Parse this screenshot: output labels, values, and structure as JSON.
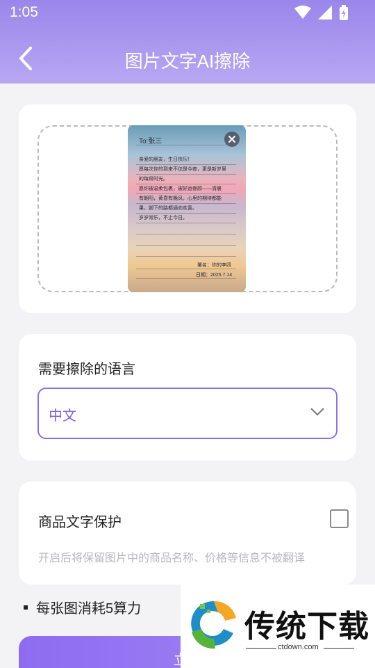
{
  "status_bar": {
    "time": "1:05"
  },
  "header": {
    "title": "图片文字AI擦除"
  },
  "upload": {
    "letter": {
      "to": "To:张三",
      "lines": [
        "亲爱的朋友，生日快乐！",
        "愿每次你的到来不仅是今夜，更是新岁里",
        "的每段时光。",
        "愿你被温柔包裹，被好运眷顾——清晨",
        "有朝阳，黄昏有晚风，心里的期待都能",
        "果，脚下的路都通向欢喜。",
        "岁岁常乐，不止今日。"
      ],
      "signature": "署名：你的李四",
      "date": "日期：2025.7.14"
    }
  },
  "language": {
    "label": "需要擦除的语言",
    "selected": "中文"
  },
  "protect": {
    "label": "商品文字保护",
    "hint": "开启后将保留图片中的商品名称、价格等信息不被翻译",
    "checked": false
  },
  "note": {
    "text": "每张图消耗5算力"
  },
  "action": {
    "label": "立即"
  },
  "watermark": {
    "brand": "传统下载",
    "domain": "ctdown.com"
  },
  "colors": {
    "accent": "#8a6fe6",
    "header_top": "#9a86ea",
    "header_bottom": "#b7a8f3"
  }
}
